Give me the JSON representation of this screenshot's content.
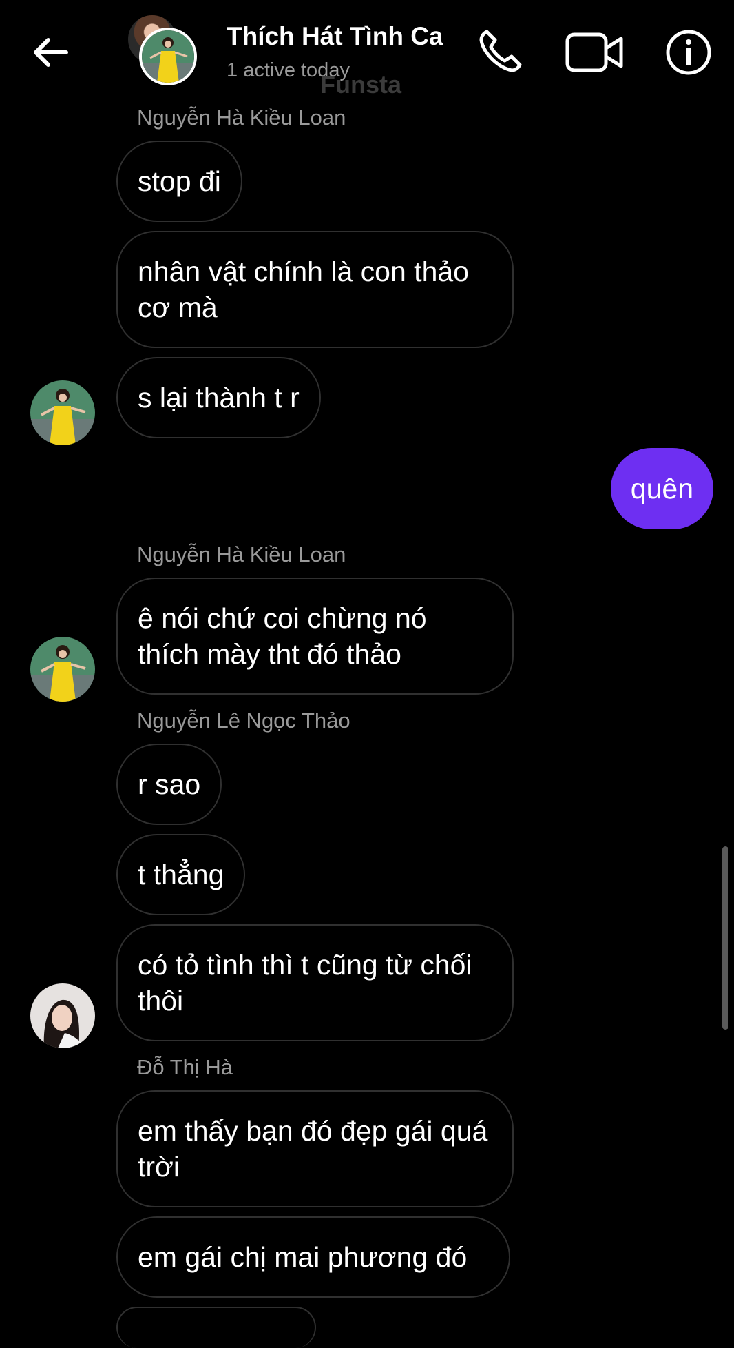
{
  "header": {
    "title": "Thích Hát Tình Ca",
    "subtitle": "1 active today",
    "watermark": "Funsta",
    "back_icon": "back-arrow-icon",
    "call_icon": "phone-icon",
    "video_icon": "video-camera-icon",
    "info_icon": "info-icon"
  },
  "colors": {
    "background": "#000000",
    "sent_bubble": "#6e2ff2",
    "received_border": "#303030",
    "name_text": "#9a9a9a"
  },
  "messages": {
    "name1": "Nguyễn Hà Kiều Loan",
    "m1": "stop đi",
    "m2": "nhân vật chính là con thảo cơ mà",
    "m3": "s lại thành t r",
    "sent1": "quên",
    "name2": "Nguyễn Hà Kiều Loan",
    "m4": "ê nói chứ coi chừng nó thích mày tht đó thảo",
    "name3": "Nguyễn Lê Ngọc Thảo",
    "m5": "r sao",
    "m6": "t thẳng",
    "m7": "có tỏ tình thì t cũng từ chối thôi",
    "name4": "Đỗ Thị Hà",
    "m8": "em thấy bạn đó đẹp gái quá trời",
    "m9": "em gái chị mai phương đó"
  }
}
